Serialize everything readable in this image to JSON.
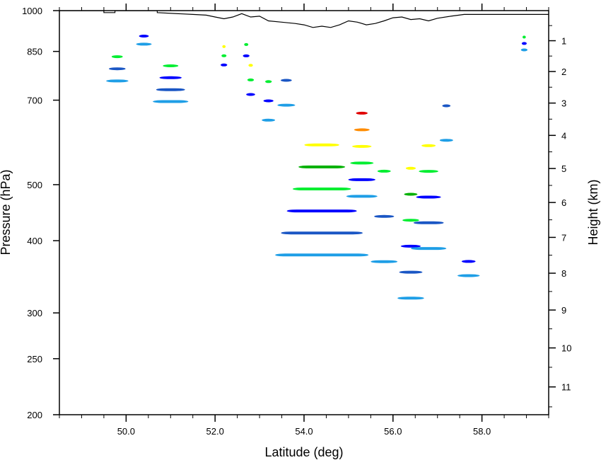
{
  "chart_data": {
    "type": "heatmap",
    "xlabel": "Latitude (deg)",
    "ylabel_left": "Pressure (hPa)",
    "ylabel_right": "Height (km)",
    "xlim": [
      48.5,
      59.5
    ],
    "pressure_range": [
      1000,
      200
    ],
    "pressure_ticks": [
      "200",
      "250",
      "300",
      "400",
      "500",
      "700",
      "850",
      "1000"
    ],
    "pressure_tick_values": [
      200,
      250,
      300,
      400,
      500,
      700,
      850,
      1000
    ],
    "x_ticks": [
      "50.0",
      "52.0",
      "54.0",
      "56.0",
      "58.0"
    ],
    "x_tick_values": [
      50.0,
      52.0,
      54.0,
      56.0,
      58.0
    ],
    "height_ticks": [
      "1",
      "2",
      "3",
      "4",
      "5",
      "6",
      "7",
      "8",
      "9",
      "10",
      "11"
    ],
    "height_tick_values": [
      1,
      2,
      3,
      4,
      5,
      6,
      7,
      8,
      9,
      10,
      11
    ],
    "level_colors": [
      "#1e9ee6",
      "#1a56c4",
      "#0000ff",
      "#00ee30",
      "#00b000",
      "#ffff00",
      "#ff8c00",
      "#e00000"
    ],
    "cells": [
      {
        "lat": 49.8,
        "width": 0.5,
        "top_hpa": 760,
        "levels": [
          1,
          2,
          4
        ]
      },
      {
        "lat": 50.4,
        "width": 0.35,
        "top_hpa": 880,
        "levels": [
          1,
          3
        ]
      },
      {
        "lat": 51.0,
        "width": 0.8,
        "top_hpa": 700,
        "levels": [
          1,
          2,
          3,
          4
        ]
      },
      {
        "lat": 52.2,
        "width": 0.15,
        "top_hpa": 810,
        "levels": [
          3,
          4,
          6
        ]
      },
      {
        "lat": 52.7,
        "width": 0.15,
        "top_hpa": 840,
        "levels": [
          3,
          4
        ]
      },
      {
        "lat": 52.8,
        "width": 0.2,
        "top_hpa": 720,
        "levels": [
          3,
          4,
          6
        ]
      },
      {
        "lat": 53.2,
        "width": 0.3,
        "top_hpa": 650,
        "levels": [
          1,
          3,
          4
        ]
      },
      {
        "lat": 53.6,
        "width": 0.4,
        "top_hpa": 690,
        "levels": [
          1,
          2
        ]
      },
      {
        "lat": 54.4,
        "width": 2.1,
        "top_hpa": 380,
        "levels": [
          1,
          2,
          3,
          4,
          5,
          6
        ]
      },
      {
        "lat": 55.3,
        "width": 0.7,
        "top_hpa": 480,
        "levels": [
          1,
          3,
          4,
          6,
          7,
          8
        ]
      },
      {
        "lat": 55.8,
        "width": 0.6,
        "top_hpa": 370,
        "levels": [
          1,
          2,
          4
        ]
      },
      {
        "lat": 56.4,
        "width": 0.6,
        "top_hpa": 320,
        "levels": [
          1,
          2,
          3,
          4,
          5,
          6
        ]
      },
      {
        "lat": 56.8,
        "width": 0.8,
        "top_hpa": 390,
        "levels": [
          1,
          2,
          3,
          4,
          6
        ]
      },
      {
        "lat": 57.2,
        "width": 0.3,
        "top_hpa": 600,
        "levels": [
          1,
          2
        ]
      },
      {
        "lat": 57.7,
        "width": 0.5,
        "top_hpa": 350,
        "levels": [
          1,
          3
        ],
        "base_hpa": 430
      },
      {
        "lat": 58.95,
        "width": 0.15,
        "top_hpa": 860,
        "levels": [
          1,
          3,
          4
        ]
      }
    ],
    "terrain": [
      {
        "lat": 48.5,
        "hpa": 1000
      },
      {
        "lat": 49.5,
        "hpa": 1000
      },
      {
        "lat": 49.5,
        "hpa": 992
      },
      {
        "lat": 49.75,
        "hpa": 992
      },
      {
        "lat": 49.75,
        "hpa": 1000
      },
      {
        "lat": 50.7,
        "hpa": 1000
      },
      {
        "lat": 50.7,
        "hpa": 992
      },
      {
        "lat": 51.5,
        "hpa": 985
      },
      {
        "lat": 51.8,
        "hpa": 982
      },
      {
        "lat": 52.0,
        "hpa": 975
      },
      {
        "lat": 52.2,
        "hpa": 968
      },
      {
        "lat": 52.4,
        "hpa": 975
      },
      {
        "lat": 52.6,
        "hpa": 988
      },
      {
        "lat": 52.8,
        "hpa": 975
      },
      {
        "lat": 53.0,
        "hpa": 978
      },
      {
        "lat": 53.2,
        "hpa": 960
      },
      {
        "lat": 53.5,
        "hpa": 955
      },
      {
        "lat": 53.8,
        "hpa": 950
      },
      {
        "lat": 54.0,
        "hpa": 945
      },
      {
        "lat": 54.2,
        "hpa": 935
      },
      {
        "lat": 54.4,
        "hpa": 940
      },
      {
        "lat": 54.6,
        "hpa": 935
      },
      {
        "lat": 54.8,
        "hpa": 945
      },
      {
        "lat": 55.0,
        "hpa": 960
      },
      {
        "lat": 55.2,
        "hpa": 955
      },
      {
        "lat": 55.4,
        "hpa": 945
      },
      {
        "lat": 55.6,
        "hpa": 950
      },
      {
        "lat": 55.8,
        "hpa": 960
      },
      {
        "lat": 56.0,
        "hpa": 972
      },
      {
        "lat": 56.2,
        "hpa": 975
      },
      {
        "lat": 56.4,
        "hpa": 965
      },
      {
        "lat": 56.6,
        "hpa": 968
      },
      {
        "lat": 56.8,
        "hpa": 960
      },
      {
        "lat": 57.0,
        "hpa": 970
      },
      {
        "lat": 57.3,
        "hpa": 978
      },
      {
        "lat": 57.6,
        "hpa": 985
      },
      {
        "lat": 59.5,
        "hpa": 985
      }
    ]
  }
}
